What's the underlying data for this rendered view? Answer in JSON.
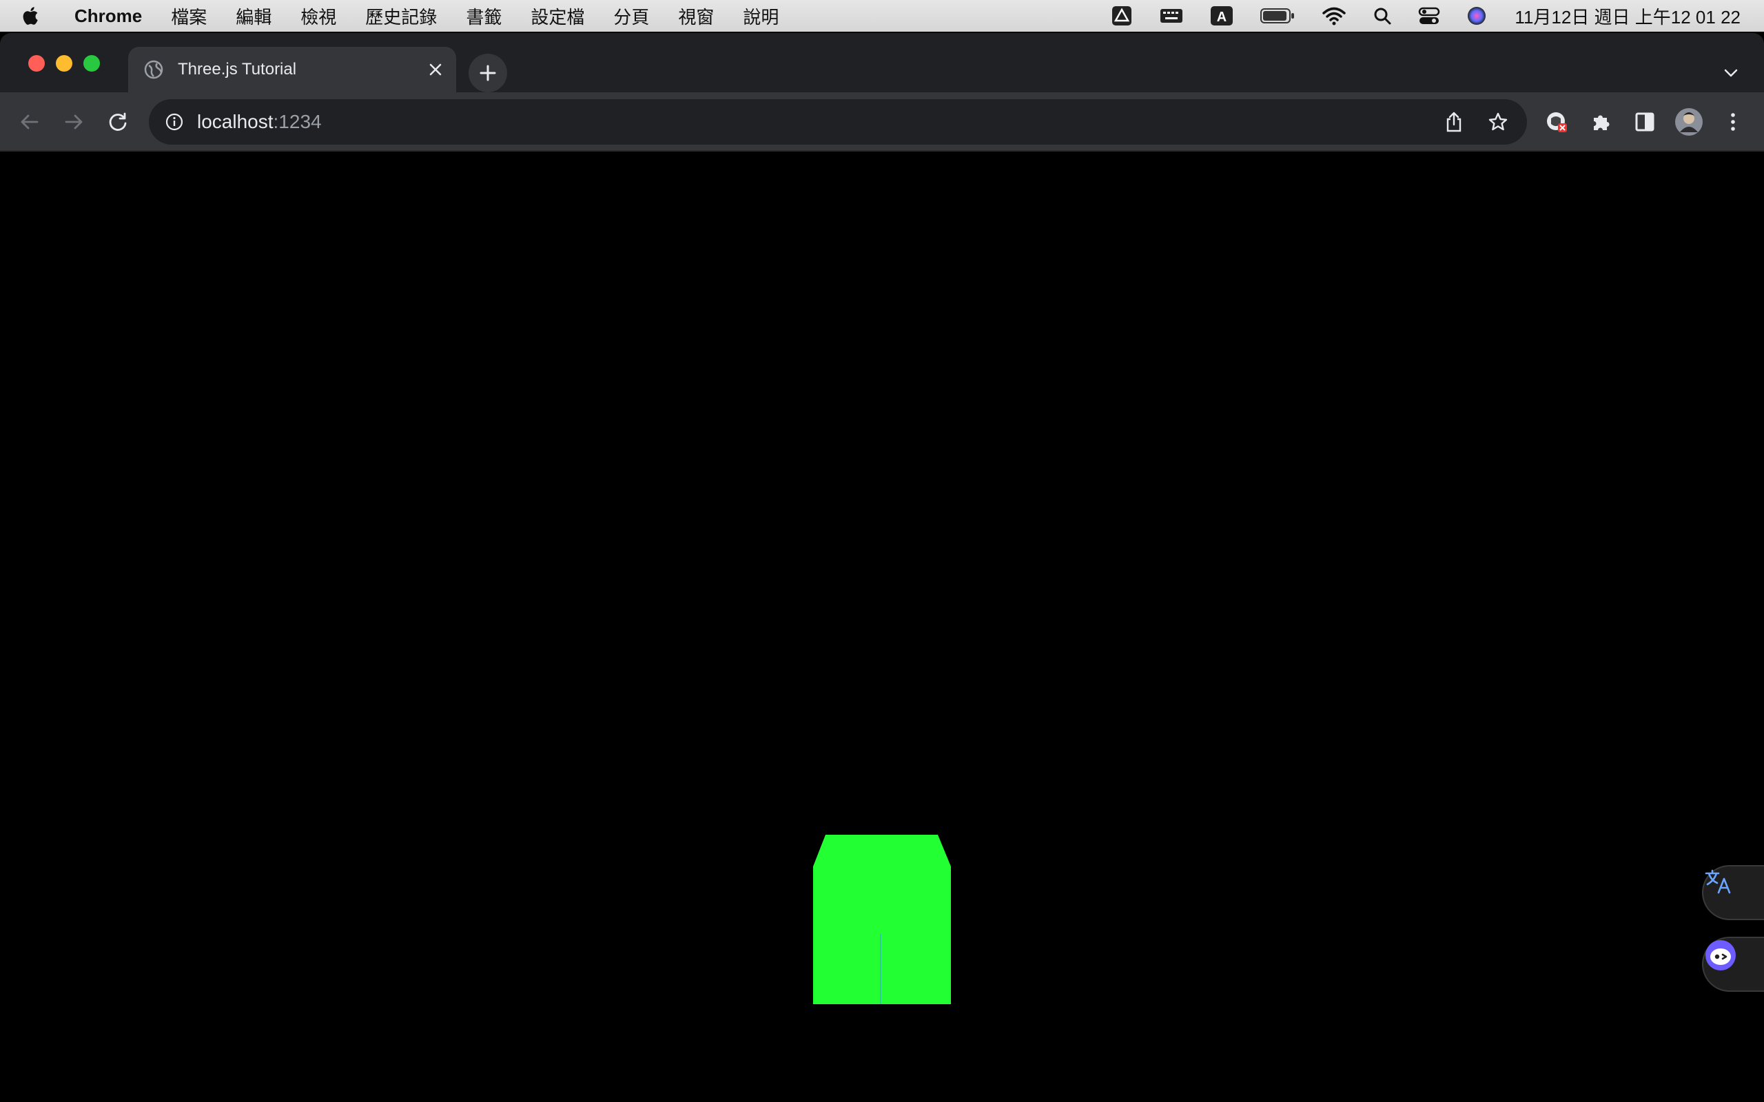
{
  "menubar": {
    "app_name": "Chrome",
    "menus": [
      "檔案",
      "編輯",
      "檢視",
      "歷史記錄",
      "書籤",
      "設定檔",
      "分頁",
      "視窗",
      "說明"
    ],
    "clock": "11月12日 週日  上午12 01 22",
    "status_icons": [
      "google-drive-icon",
      "keyboard-icon",
      "input-source-icon",
      "battery-icon",
      "wifi-icon",
      "spotlight-icon",
      "control-center-icon",
      "siri-icon"
    ]
  },
  "browser": {
    "tab": {
      "title": "Three.js Tutorial",
      "favicon": "globe-icon"
    },
    "address": {
      "host": "localhost",
      "port": ":1234"
    },
    "toolbar_icons": [
      "back-icon",
      "forward-icon",
      "reload-icon",
      "share-icon",
      "bookmark-star-icon",
      "extension-blocked-icon",
      "puzzle-icon",
      "side-panel-icon",
      "avatar",
      "more-icon"
    ]
  },
  "scene": {
    "background": "#000000",
    "cube_color": "#22ff33",
    "axis_colors": {
      "x": "#ff8800",
      "y": "#66ff33",
      "z": "#3399ff"
    }
  },
  "floating_buttons": [
    "translate-icon",
    "assistant-icon"
  ]
}
